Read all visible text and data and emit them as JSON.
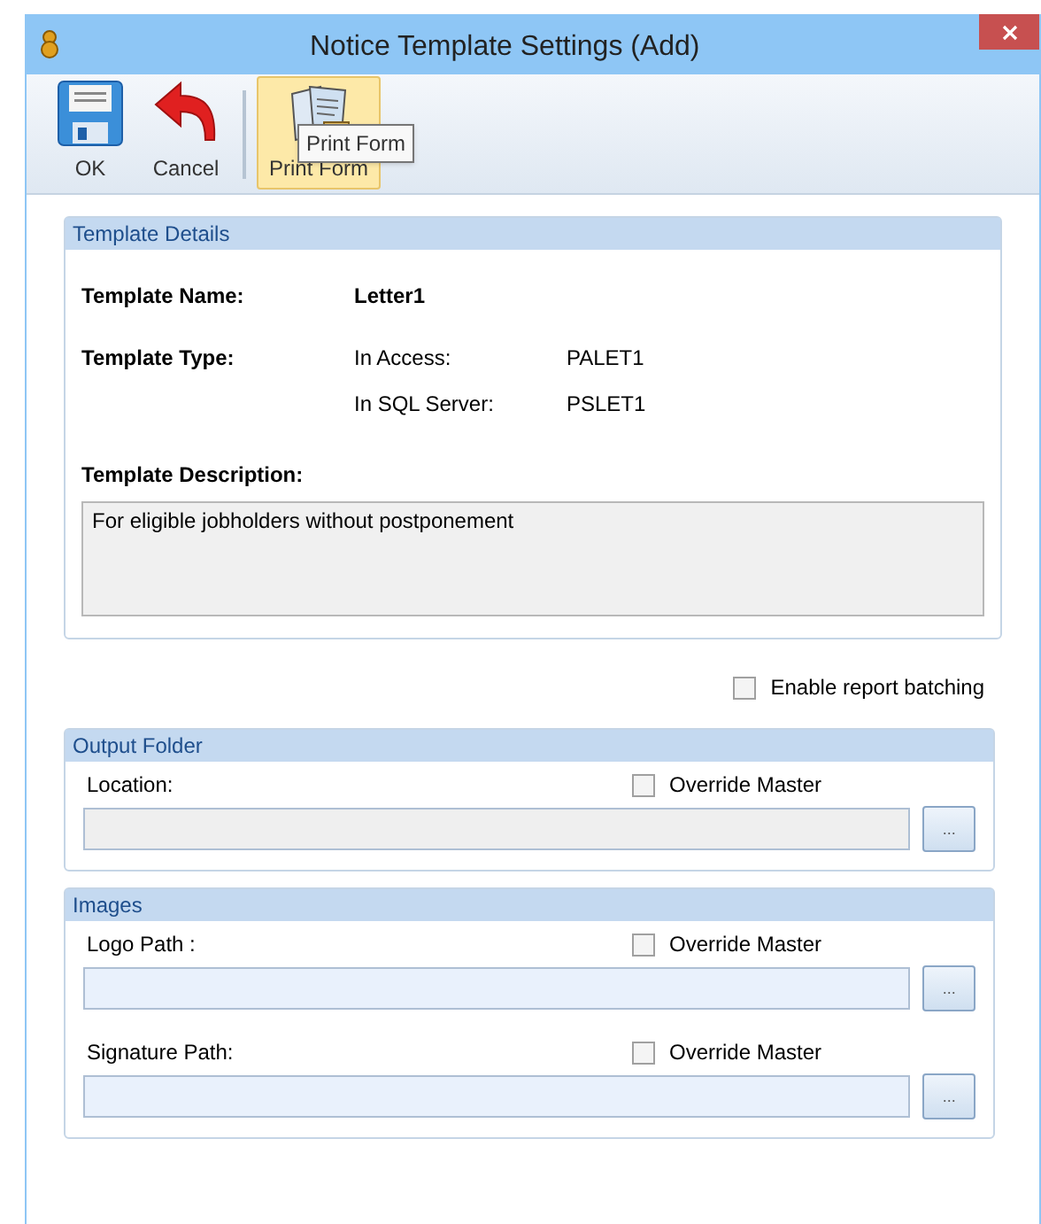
{
  "window": {
    "title": "Notice Template Settings (Add)"
  },
  "toolbar": [
    {
      "kind": "save",
      "label": "OK",
      "selected": false
    },
    {
      "kind": "undo",
      "label": "Cancel",
      "selected": false
    },
    {
      "kind": "print",
      "label": "Print Form",
      "selected": true
    }
  ],
  "tooltip": "Print Form",
  "template_details": {
    "title": "Template Details",
    "name_label": "Template Name:",
    "name_value": "Letter1",
    "type_label": "Template Type:",
    "types": [
      {
        "label": "In Access:",
        "value": "PALET1"
      },
      {
        "label": "In SQL Server:",
        "value": "PSLET1"
      }
    ],
    "description_label": "Template Description:",
    "description": "For eligible jobholders without postponement"
  },
  "enable_batching": {
    "label": "Enable report batching",
    "checked": false
  },
  "groups": [
    {
      "title": "Output Folder",
      "fields": [
        {
          "label": "Location:",
          "override_label": "Override Master",
          "checked": false,
          "disabled": true,
          "browse": "..."
        }
      ]
    },
    {
      "title": "Images",
      "fields": [
        {
          "label": "Logo Path :",
          "override_label": "Override Master",
          "checked": false,
          "disabled": false,
          "browse": "..."
        },
        {
          "label": "Signature Path:",
          "override_label": "Override Master",
          "checked": false,
          "disabled": false,
          "browse": "..."
        }
      ]
    }
  ]
}
